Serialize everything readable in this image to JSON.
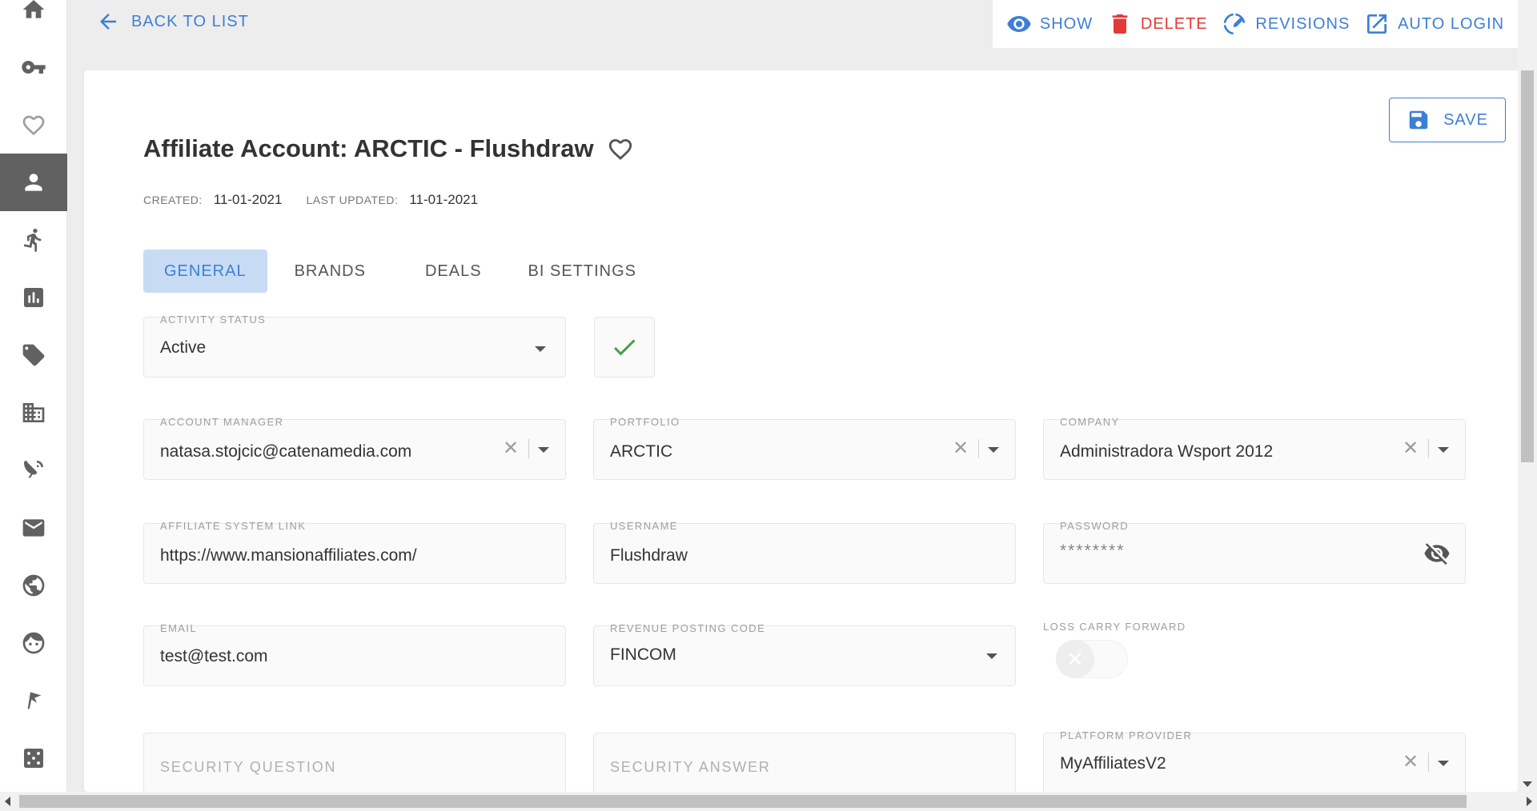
{
  "sidebar": {
    "items": [
      {
        "icon": "home-icon"
      },
      {
        "icon": "key-icon"
      },
      {
        "icon": "heart-icon"
      },
      {
        "icon": "person-icon",
        "active": true
      },
      {
        "icon": "running-person-icon"
      },
      {
        "icon": "bar-chart-icon"
      },
      {
        "icon": "tag-icon"
      },
      {
        "icon": "building-icon"
      },
      {
        "icon": "satellite-dish-icon"
      },
      {
        "icon": "mail-icon"
      },
      {
        "icon": "globe-icon"
      },
      {
        "icon": "face-icon"
      },
      {
        "icon": "flag-icon"
      },
      {
        "icon": "dice-icon"
      }
    ]
  },
  "topbar": {
    "back_label": "BACK TO LIST",
    "actions": {
      "show": "SHOW",
      "delete": "DELETE",
      "revisions": "REVISIONS",
      "auto_login": "AUTO LOGIN"
    }
  },
  "colors": {
    "accent": "#3d7fd6",
    "danger": "#e53935",
    "success": "#43a047",
    "active_tab_bg": "#c7dcf4"
  },
  "page": {
    "save_label": "SAVE",
    "title": "Affiliate Account: ARCTIC - Flushdraw",
    "created_label": "CREATED:",
    "created_value": "11-01-2021",
    "updated_label": "LAST UPDATED:",
    "updated_value": "11-01-2021"
  },
  "tabs": [
    "GENERAL",
    "BRANDS",
    "DEALS",
    "BI SETTINGS"
  ],
  "form": {
    "activity_status": {
      "label": "ACTIVITY STATUS",
      "value": "Active"
    },
    "account_manager": {
      "label": "ACCOUNT MANAGER",
      "value": "natasa.stojcic@catenamedia.com"
    },
    "portfolio": {
      "label": "PORTFOLIO",
      "value": "ARCTIC"
    },
    "company": {
      "label": "COMPANY",
      "value": "Administradora Wsport 2012"
    },
    "affiliate_system_link": {
      "label": "AFFILIATE SYSTEM LINK",
      "value": "https://www.mansionaffiliates.com/"
    },
    "username": {
      "label": "USERNAME",
      "value": "Flushdraw"
    },
    "password": {
      "label": "PASSWORD",
      "value": "********"
    },
    "email": {
      "label": "EMAIL",
      "value": "test@test.com"
    },
    "revenue_posting_code": {
      "label": "REVENUE POSTING CODE",
      "value": "FINCOM"
    },
    "loss_carry_forward": {
      "label": "LOSS CARRY FORWARD",
      "enabled": false
    },
    "security_question": {
      "placeholder": "SECURITY QUESTION"
    },
    "security_answer": {
      "placeholder": "SECURITY ANSWER"
    },
    "platform_provider": {
      "label": "PLATFORM PROVIDER",
      "value": "MyAffiliatesV2"
    }
  }
}
